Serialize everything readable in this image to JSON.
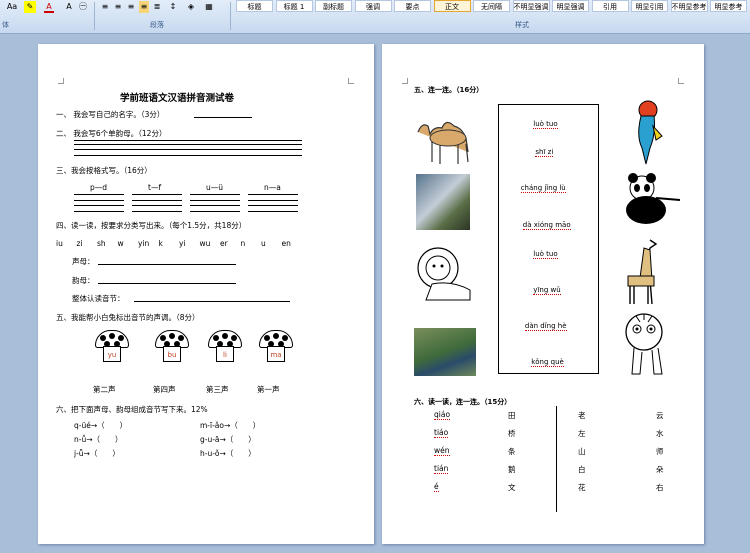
{
  "ribbon": {
    "font_group_label": "体",
    "paragraph_group_label": "段落",
    "styles_group_label": "样式",
    "aa_label": "Aa",
    "style_buttons": [
      "标题",
      "标题 1",
      "副标题",
      "强调",
      "要点",
      "正文",
      "无间隔",
      "不明显强调",
      "明显强调",
      "引用",
      "明显引用",
      "不明显参考",
      "明显参考"
    ]
  },
  "left_page": {
    "title": "学前班语文汉语拼音测试卷",
    "q1": "一、 我会写自己的名字。（3分）",
    "q2": "二、 我会写6个单韵母。（12分）",
    "q3": "三、我会按格式写。（16分）",
    "q3_items": [
      "p—d",
      "t—f",
      "u—ü",
      "n—a"
    ],
    "q4": "四、读一读，按要求分类写出来。（每个1.5分，共18分）",
    "q4_letters": [
      "iu",
      "zi",
      "sh",
      "w",
      "yin",
      "k",
      "yi",
      "wu",
      "er",
      "n",
      "u",
      "en"
    ],
    "q4_sheng": "声母：",
    "q4_yun": "韵母：",
    "q4_zhengti": "整体认读音节：",
    "q5": "五、我能帮小白兔标出音节的声调。（8分）",
    "q5_syllables": [
      "yu",
      "bu",
      "li",
      "ma"
    ],
    "q5_tones": [
      "第二声",
      "第四声",
      "第三声",
      "第一声"
    ],
    "q6": "六、把下面声母、韵母组成音节写下来。12%",
    "q6_items": [
      "q-üé→（　　）",
      "m-ī-ǎo→（　　）",
      "n-ǚ→（　　）",
      "g-u-ā→（　　）",
      "j-ǖ→（　　）",
      "h-u-ǒ→（　　）"
    ]
  },
  "right_page": {
    "q5": "五、连一连。（16分）",
    "pinyin": [
      "luò tuo",
      "shī zi",
      "cháng jǐng lù",
      "dà xióng māo",
      "luò tuo",
      "yīng wǔ",
      "dàn dǐng hè",
      "kǒng què"
    ],
    "q6": "六、读一读，连一连。（15分）",
    "q6_left_pinyin": [
      "qiáo",
      "tiáo",
      "wén",
      "tián",
      "é"
    ],
    "q6_left_chars": [
      "田",
      "桥",
      "条",
      "鹅",
      "文"
    ],
    "q6_right_a": [
      "老",
      "左",
      "山",
      "白",
      "花"
    ],
    "q6_right_b": [
      "云",
      "水",
      "师",
      "朵",
      "右"
    ]
  }
}
